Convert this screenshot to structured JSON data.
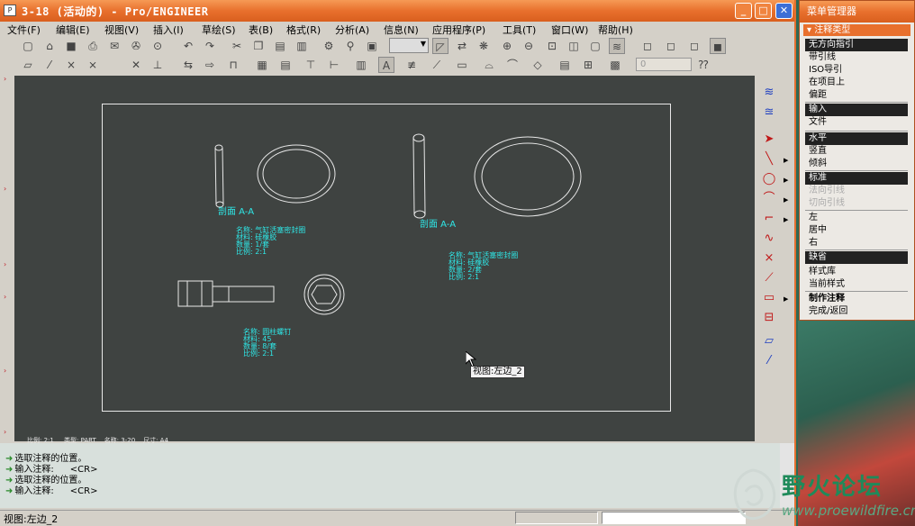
{
  "window": {
    "title": "3-18 (活动的) - Pro/ENGINEER",
    "minimize_glyph": "_",
    "maximize_glyph": "□",
    "close_glyph": "✕"
  },
  "menubar": {
    "items": [
      {
        "label": "文件(F)"
      },
      {
        "label": "编辑(E)"
      },
      {
        "label": "视图(V)"
      },
      {
        "label": "插入(I)"
      },
      {
        "label": "草绘(S)"
      },
      {
        "label": "表(B)"
      },
      {
        "label": "格式(R)"
      },
      {
        "label": "分析(A)"
      },
      {
        "label": "信息(N)"
      },
      {
        "label": "应用程序(P)"
      },
      {
        "label": "工具(T)"
      },
      {
        "label": "窗口(W)"
      },
      {
        "label": "帮助(H)"
      }
    ]
  },
  "toolbar": {
    "row1_icons": [
      "new-icon",
      "open-icon",
      "save-icon",
      "print-icon",
      "email-icon",
      "send-icon",
      "undo-icon",
      "redo-icon",
      "cut-icon",
      "copy-icon",
      "paste-icon",
      "paste-special-icon",
      "regenerate-icon",
      "find-icon",
      "select-box-icon",
      "sketch-icon",
      "spin-center-icon",
      "zoom-window-icon",
      "zoom-in-icon",
      "zoom-out-icon",
      "refit-icon",
      "repaint-icon",
      "layer-icon",
      "wireframe-icon",
      "hidden-line-icon",
      "no-hidden-icon",
      "shading-icon"
    ],
    "row2_icons": [
      "plane-icon",
      "axis-icon",
      "point-icon",
      "csys-icon",
      "delete-icon",
      "move-icon",
      "insert-view-icon",
      "table-icon",
      "table-from-file-icon",
      "hatch-icon",
      "ordinate-icon",
      "dim-icon",
      "note-icon",
      "balloon-icon",
      "symbol-icon",
      "gtol-icon",
      "surface-finish-icon",
      "datum-target-icon",
      "move-special-icon",
      "snap-icon",
      "layout-icon",
      "grid-icon",
      "help-icon"
    ],
    "spin_value": "0"
  },
  "drawing": {
    "section_label_1": "剖面 A-A",
    "section_label_2": "剖面 A-A",
    "note1": [
      "名称: 气缸活塞密封圈",
      "材料: 硅橡胶",
      "数量: 1/套",
      "比例: 2:1"
    ],
    "note2": [
      "名称: 气缸活塞密封圈",
      "材料: 硅橡胶",
      "数量: 2/套",
      "比例: 2:1"
    ],
    "note3": [
      "名称: 圆柱螺钉",
      "材料: 45",
      "数量: 8/套",
      "比例: 2:1"
    ],
    "status_info": [
      "比例: 2:1",
      "类型: PART",
      "名称: 3-20",
      "尺寸: A4"
    ],
    "tooltip": "视图:左边_2"
  },
  "messages": [
    {
      "text": "选取注释的位置。",
      "cr": ""
    },
    {
      "text": "输入注释:",
      "cr": "<CR>"
    },
    {
      "text": "选取注释的位置。",
      "cr": ""
    },
    {
      "text": "输入注释:",
      "cr": "<CR>"
    }
  ],
  "statusbar": {
    "text": "视图:左边_2"
  },
  "menu_manager": {
    "title": "菜单管理器",
    "header": "注释类型",
    "items": [
      {
        "label": "无方向指引",
        "state": "selected"
      },
      {
        "label": "带引线",
        "state": "normal"
      },
      {
        "label": "ISO导引",
        "state": "normal"
      },
      {
        "label": "在项目上",
        "state": "normal"
      },
      {
        "label": "偏距",
        "state": "normal"
      },
      {
        "label": "输入",
        "state": "selected"
      },
      {
        "label": "文件",
        "state": "normal"
      },
      {
        "label": "水平",
        "state": "selected"
      },
      {
        "label": "竖直",
        "state": "normal"
      },
      {
        "label": "倾斜",
        "state": "normal"
      },
      {
        "label": "标准",
        "state": "selected"
      },
      {
        "label": "法向引线",
        "state": "disabled"
      },
      {
        "label": "切向引线",
        "state": "disabled"
      },
      {
        "label": "左",
        "state": "normal"
      },
      {
        "label": "居中",
        "state": "normal"
      },
      {
        "label": "右",
        "state": "normal"
      },
      {
        "label": "缺省",
        "state": "selected"
      },
      {
        "label": "样式库",
        "state": "normal"
      },
      {
        "label": "当前样式",
        "state": "normal"
      },
      {
        "label": "制作注释",
        "state": "bold"
      },
      {
        "label": "完成/返回",
        "state": "normal"
      }
    ]
  },
  "watermark": {
    "text": "野火论坛",
    "url": "www.proewildfire.cn"
  },
  "colors": {
    "accent": "#e8702d",
    "canvas": "#3f4341",
    "note": "#2ee8e8",
    "line": "#e8e8e8"
  }
}
